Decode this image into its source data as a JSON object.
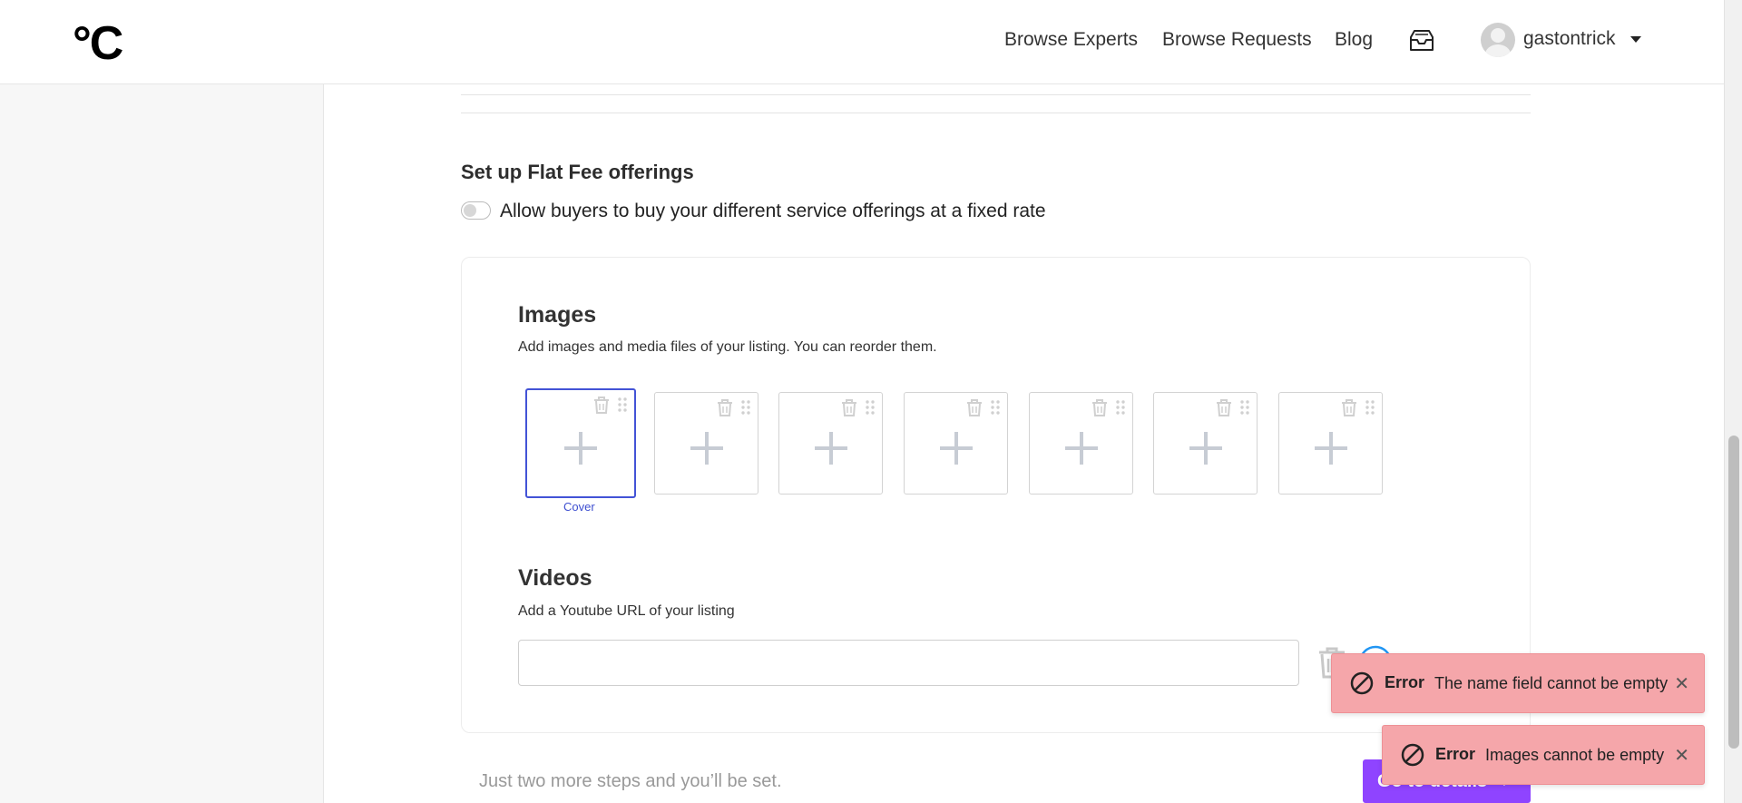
{
  "header": {
    "logo": "°C",
    "nav": [
      "Browse Experts",
      "Browse Requests",
      "Blog"
    ],
    "inbox_icon": "inbox-icon",
    "username": "gastontrick"
  },
  "flat_fee": {
    "title": "Set up Flat Fee offerings",
    "toggle_label": "Allow buyers to buy your different service offerings at a fixed rate",
    "toggle_on": false
  },
  "images": {
    "title": "Images",
    "subtitle": "Add images and media files of your listing. You can reorder them.",
    "cover_label": "Cover",
    "slot_count": 7
  },
  "videos": {
    "title": "Videos",
    "subtitle": "Add a Youtube URL of your listing",
    "url_value": ""
  },
  "footer": {
    "note": "Just two more steps and you’ll be set.",
    "next_button": "Go to details →"
  },
  "toasts": [
    {
      "title": "Error",
      "message": "The name field cannot be empty"
    },
    {
      "title": "Error",
      "message": "Images cannot be empty"
    }
  ],
  "colors": {
    "accent": "#4353d6",
    "primary_button": "#8f44ff",
    "error_toast": "#f5a6aa",
    "add_button": "#2196f3"
  }
}
